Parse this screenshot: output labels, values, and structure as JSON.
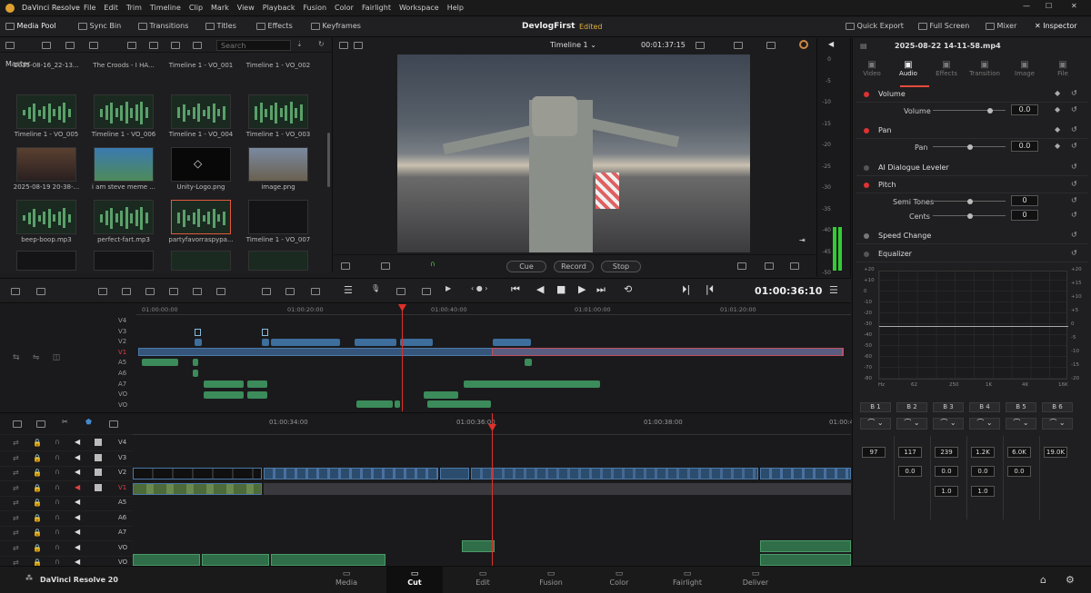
{
  "menubar": {
    "app": "DaVinci Resolve",
    "items": [
      "File",
      "Edit",
      "Trim",
      "Timeline",
      "Clip",
      "Mark",
      "View",
      "Playback",
      "Fusion",
      "Color",
      "Fairlight",
      "Workspace",
      "Help"
    ]
  },
  "toolbar": {
    "media_pool": "Media Pool",
    "sync_bin": "Sync Bin",
    "transitions": "Transitions",
    "titles": "Titles",
    "effects": "Effects",
    "keyframes": "Keyframes",
    "project": "DevlogFirst",
    "status": "Edited",
    "quick_export": "Quick Export",
    "full_screen": "Full Screen",
    "mixer": "Mixer",
    "inspector": "Inspector"
  },
  "media": {
    "search_placeholder": "Search",
    "bin": "Master",
    "row0": [
      "2025-08-16_22-13...",
      "The Croods - I HA...",
      "Timeline 1 - VO_001",
      "Timeline 1 - VO_002"
    ],
    "row1": [
      "Timeline 1 - VO_005",
      "Timeline 1 - VO_006",
      "Timeline 1 - VO_004",
      "Timeline 1 - VO_003"
    ],
    "row2": [
      "2025-08-19 20-38-...",
      "i am steve meme ...",
      "Unity-Logo.png",
      "image.png"
    ],
    "row3": [
      "beep-boop.mp3",
      "perfect-fart.mp3",
      "partyfavorraspypa...",
      "Timeline 1 - VO_007"
    ]
  },
  "viewer": {
    "timeline": "Timeline 1",
    "duration": "00:01:37:15",
    "cue": "Cue",
    "record": "Record",
    "stop": "Stop",
    "timecode": "01:00:36:10"
  },
  "meter": {
    "ticks": [
      "0",
      "-5",
      "-10",
      "-15",
      "-20",
      "-25",
      "-30",
      "-35",
      "-40",
      "-45",
      "-50"
    ]
  },
  "ruler": {
    "upper": [
      "01:00:00:00",
      "01:00:20:00",
      "01:00:40:00",
      "01:01:00:00",
      "01:01:20:00"
    ],
    "lower": [
      "01:00:34:00",
      "01:00:36:00",
      "01:00:38:00",
      "01:00:4"
    ]
  },
  "tracks": {
    "upper": [
      "V4",
      "V3",
      "V2",
      "V1",
      "A5",
      "A6",
      "A7",
      "VO",
      "VO"
    ],
    "lower": [
      "V4",
      "V3",
      "V2",
      "V1",
      "A5",
      "A6",
      "A7",
      "VO",
      "VO"
    ]
  },
  "inspector": {
    "clip": "2025-08-22 14-11-58.mp4",
    "tabs": [
      "Video",
      "Audio",
      "Effects",
      "Transition",
      "Image",
      "File"
    ],
    "volume": "Volume",
    "volume_sub": "Volume",
    "volume_val": "0.0",
    "pan": "Pan",
    "pan_sub": "Pan",
    "pan_val": "0.0",
    "dialogue": "AI Dialogue Leveler",
    "pitch": "Pitch",
    "semi": "Semi Tones",
    "semi_val": "0",
    "cents": "Cents",
    "cents_val": "0",
    "speed": "Speed Change",
    "eq": "Equalizer",
    "eq_y": [
      "+20",
      "+10",
      "0",
      "-10",
      "-20",
      "-30",
      "-40",
      "-50",
      "-60",
      "-70",
      "-80"
    ],
    "eq_y2": [
      "+20",
      "+15",
      "+10",
      "+5",
      "0",
      "-5",
      "-10",
      "-15",
      "-20"
    ],
    "eq_x": [
      "Hz",
      "62",
      "250",
      "1K",
      "4K",
      "16K"
    ],
    "bands": [
      "B 1",
      "B 2",
      "B 3",
      "B 4",
      "B 5",
      "B 6"
    ],
    "freq": [
      "97",
      "117",
      "239",
      "1.2K",
      "6.0K",
      "19.0K"
    ],
    "gain": [
      "0.0",
      "0.0",
      "0.0",
      "0.0"
    ],
    "q": [
      "1.0",
      "1.0"
    ]
  },
  "bottom": {
    "brand": "DaVinci Resolve 20",
    "pages": [
      "Media",
      "Cut",
      "Edit",
      "Fusion",
      "Color",
      "Fairlight",
      "Deliver"
    ]
  },
  "colors": {
    "accent": "#e54b3c",
    "blue_clip": "#3d6e9c",
    "green_clip": "#3c8b5a",
    "playhead": "#e0302a"
  }
}
